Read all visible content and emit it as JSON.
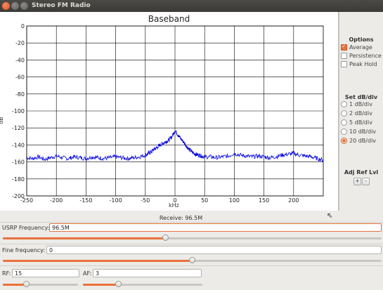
{
  "window": {
    "title": "Stereo FM Radio"
  },
  "plot": {
    "title": "Baseband",
    "ylabel": "dB",
    "xlabel": "kHz",
    "yticks": [
      "0",
      "-20",
      "-40",
      "-60",
      "-80",
      "-100",
      "-120",
      "-140",
      "-160",
      "-180",
      "-200"
    ],
    "xticks": [
      "-250",
      "-200",
      "-150",
      "-100",
      "-50",
      "0",
      "50",
      "100",
      "150",
      "200"
    ],
    "trace_color": "#0000dd"
  },
  "chart_data": {
    "type": "line",
    "title": "Baseband",
    "xlabel": "kHz",
    "ylabel": "dB",
    "xlim": [
      -250,
      250
    ],
    "ylim": [
      -200,
      0
    ],
    "grid": true,
    "series": [
      {
        "x": [
          -250,
          -240,
          -230,
          -220,
          -210,
          -200,
          -190,
          -180,
          -170,
          -160,
          -150,
          -140,
          -130,
          -120,
          -110,
          -100,
          -90,
          -80,
          -70,
          -60,
          -50,
          -45,
          -40,
          -35,
          -30,
          -25,
          -20,
          -15,
          -10,
          -5,
          0,
          5,
          10,
          15,
          20,
          25,
          30,
          35,
          40,
          45,
          50,
          60,
          70,
          80,
          90,
          100,
          110,
          120,
          130,
          140,
          150,
          160,
          170,
          180,
          190,
          200,
          210,
          220,
          230,
          240,
          250
        ],
        "values": [
          -155,
          -156,
          -154,
          -157,
          -155,
          -153,
          -155,
          -156,
          -154,
          -155,
          -156,
          -154,
          -155,
          -156,
          -155,
          -154,
          -155,
          -156,
          -155,
          -154,
          -152,
          -150,
          -148,
          -145,
          -143,
          -140,
          -138,
          -136,
          -134,
          -130,
          -123,
          -128,
          -133,
          -137,
          -142,
          -146,
          -149,
          -151,
          -152,
          -153,
          -154,
          -154,
          -155,
          -154,
          -153,
          -150,
          -152,
          -153,
          -154,
          -153,
          -154,
          -155,
          -154,
          -152,
          -151,
          -150,
          -152,
          -153,
          -154,
          -156,
          -158
        ]
      }
    ]
  },
  "options": {
    "title": "Options",
    "items": [
      {
        "label": "Average",
        "checked": true
      },
      {
        "label": "Persistence",
        "checked": false
      },
      {
        "label": "Peak Hold",
        "checked": false
      }
    ],
    "db_title": "Set dB/div",
    "db_options": [
      {
        "label": "1 dB/div",
        "selected": false
      },
      {
        "label": "2 dB/div",
        "selected": false
      },
      {
        "label": "5 dB/div",
        "selected": false
      },
      {
        "label": "10 dB/div",
        "selected": false
      },
      {
        "label": "20 dB/div",
        "selected": true
      }
    ],
    "ref_title": "Adj Ref Lvl",
    "plus": "+",
    "minus": "-"
  },
  "status": {
    "receive": "Receive: 96.5M"
  },
  "controls": {
    "usrp_label": "USRP Frequency:",
    "usrp_value": "96.5M",
    "usrp_level": 0.43,
    "fine_label": "Fine frequency:",
    "fine_value": "0",
    "fine_level": 0.5,
    "rf_label": "RF:",
    "rf_value": "15",
    "rf_level": 0.32,
    "af_label": "AF:",
    "af_value": "3",
    "af_level": 0.3
  },
  "colors": {
    "accent": "#e8723b"
  }
}
